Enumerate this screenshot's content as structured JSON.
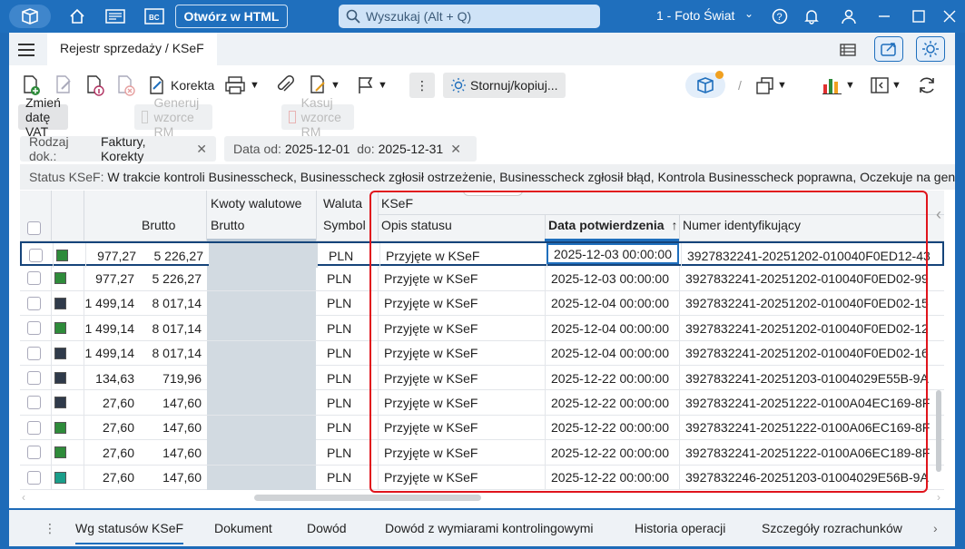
{
  "titlebar": {
    "html_button": "Otwórz w HTML",
    "search_placeholder": "Wyszukaj (Alt + Q)",
    "company": "1 - Foto Świat"
  },
  "tab": {
    "label": "Rejestr sprzedaży / KSeF"
  },
  "toolbar": {
    "korekta": "Korekta",
    "stornuj": "Stornuj/kopiuj..."
  },
  "row2": {
    "zmien": "Zmień datę VAT",
    "generuj": "Generuj wzorce RM",
    "kasuj": "Kasuj wzorce RM"
  },
  "filters": {
    "rodzaj_label": "Rodzaj dok.:",
    "rodzaj_value": "Faktury, Korekty",
    "data_label": "Data  od:",
    "data_od": "2025-12-01",
    "data_do_label": "do:",
    "data_do": "2025-12-31",
    "status_label": "Status KSeF:",
    "status_value": "W trakcie kontroli Businesscheck, Businesscheck zgłosił ostrzeżenie, Businesscheck zgłosił błąd, Kontrola Businesscheck poprawna, Oczekuje na gen"
  },
  "grid": {
    "headers": {
      "brutto": "Brutto",
      "kwoty_top": "Kwoty walutowe",
      "kwoty_bottom": "Brutto",
      "waluta_top": "Waluta",
      "waluta_bottom": "Symbol",
      "ksef_group": "KSeF",
      "opis": "Opis statusu",
      "data_potw": "Data potwierdzenia",
      "numer": "Numer identyfikujący"
    },
    "rows": [
      {
        "netto": "977,27",
        "brutto": "5 226,27",
        "waluta": "PLN",
        "opis": "Przyjęte w KSeF",
        "data": "2025-12-03 00:00:00",
        "numer": "3927832241-20251202-010040F0ED12-43",
        "color": "#2e8b3a"
      },
      {
        "netto": "977,27",
        "brutto": "5 226,27",
        "waluta": "PLN",
        "opis": "Przyjęte w KSeF",
        "data": "2025-12-03 00:00:00",
        "numer": "3927832241-20251202-010040F0ED02-99",
        "color": "#2e8b3a"
      },
      {
        "netto": "1 499,14",
        "brutto": "8 017,14",
        "waluta": "PLN",
        "opis": "Przyjęte w KSeF",
        "data": "2025-12-04 00:00:00",
        "numer": "3927832241-20251202-010040F0ED02-15",
        "color": "#2f3a4a"
      },
      {
        "netto": "1 499,14",
        "brutto": "8 017,14",
        "waluta": "PLN",
        "opis": "Przyjęte w KSeF",
        "data": "2025-12-04 00:00:00",
        "numer": "3927832241-20251202-010040F0ED02-12",
        "color": "#2e8b3a"
      },
      {
        "netto": "1 499,14",
        "brutto": "8 017,14",
        "waluta": "PLN",
        "opis": "Przyjęte w KSeF",
        "data": "2025-12-04 00:00:00",
        "numer": "3927832241-20251202-010040F0ED02-16",
        "color": "#2f3a4a"
      },
      {
        "netto": "134,63",
        "brutto": "719,96",
        "waluta": "PLN",
        "opis": "Przyjęte w KSeF",
        "data": "2025-12-22 00:00:00",
        "numer": "3927832241-20251203-01004029E55B-9A",
        "color": "#2f3a4a"
      },
      {
        "netto": "27,60",
        "brutto": "147,60",
        "waluta": "PLN",
        "opis": "Przyjęte w KSeF",
        "data": "2025-12-22 00:00:00",
        "numer": "3927832241-20251222-0100A04EC169-8F",
        "color": "#2f3a4a"
      },
      {
        "netto": "27,60",
        "brutto": "147,60",
        "waluta": "PLN",
        "opis": "Przyjęte w KSeF",
        "data": "2025-12-22 00:00:00",
        "numer": "3927832241-20251222-0100A06EC169-8F",
        "color": "#2e8b3a"
      },
      {
        "netto": "27,60",
        "brutto": "147,60",
        "waluta": "PLN",
        "opis": "Przyjęte w KSeF",
        "data": "2025-12-22 00:00:00",
        "numer": "3927832241-20251222-0100A06EC189-8F",
        "color": "#2e8b3a"
      },
      {
        "netto": "27,60",
        "brutto": "147,60",
        "waluta": "PLN",
        "opis": "Przyjęte w KSeF",
        "data": "2025-12-22 00:00:00",
        "numer": "3927832246-20251203-01004029E56B-9A",
        "color": "#1a9e8a"
      }
    ]
  },
  "bottom_tabs": [
    "Wg statusów KSeF",
    "Dokument",
    "Dowód",
    "Dowód z wymiarami kontrolingowymi",
    "Historia operacji",
    "Szczegóły rozrachunków"
  ]
}
